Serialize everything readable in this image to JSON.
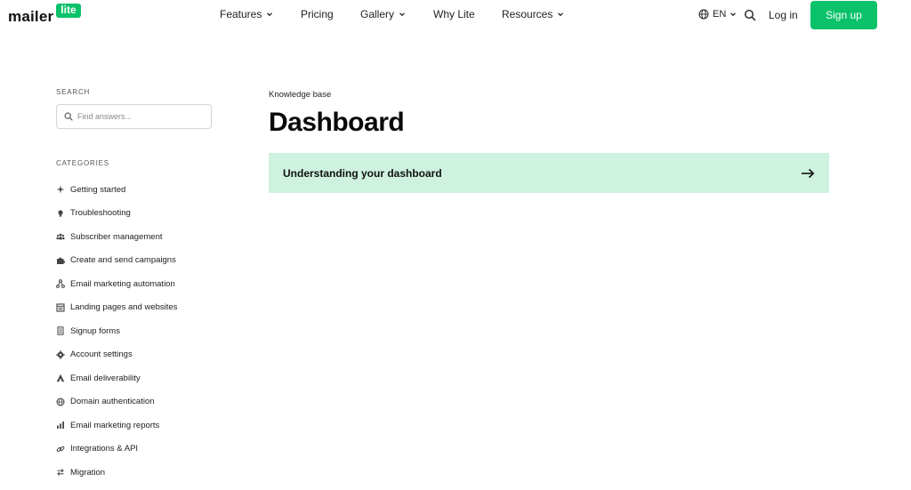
{
  "brand": {
    "word": "mailer",
    "badge": "lite",
    "accent": "#09c269"
  },
  "nav": {
    "items": [
      {
        "label": "Features",
        "dropdown": true
      },
      {
        "label": "Pricing",
        "dropdown": false
      },
      {
        "label": "Gallery",
        "dropdown": true
      },
      {
        "label": "Why Lite",
        "dropdown": false
      },
      {
        "label": "Resources",
        "dropdown": true
      }
    ],
    "language": "EN",
    "login": "Log in",
    "signup": "Sign up"
  },
  "sidebar": {
    "search_label": "SEARCH",
    "search_placeholder": "Find answers...",
    "categories_label": "CATEGORIES",
    "categories": [
      {
        "label": "Getting started",
        "icon": "sparkle-icon"
      },
      {
        "label": "Troubleshooting",
        "icon": "lightbulb-icon"
      },
      {
        "label": "Subscriber management",
        "icon": "users-icon"
      },
      {
        "label": "Create and send campaigns",
        "icon": "puzzle-icon"
      },
      {
        "label": "Email marketing automation",
        "icon": "workflow-icon"
      },
      {
        "label": "Landing pages and websites",
        "icon": "page-icon"
      },
      {
        "label": "Signup forms",
        "icon": "form-icon"
      },
      {
        "label": "Account settings",
        "icon": "gear-icon"
      },
      {
        "label": "Email deliverability",
        "icon": "triangle-icon"
      },
      {
        "label": "Domain authentication",
        "icon": "globe-icon"
      },
      {
        "label": "Email marketing reports",
        "icon": "bar-chart-icon"
      },
      {
        "label": "Integrations & API",
        "icon": "link-icon"
      },
      {
        "label": "Migration",
        "icon": "swap-icon"
      }
    ]
  },
  "main": {
    "breadcrumb": "Knowledge base",
    "title": "Dashboard",
    "articles": [
      {
        "title": "Understanding your dashboard"
      }
    ]
  }
}
